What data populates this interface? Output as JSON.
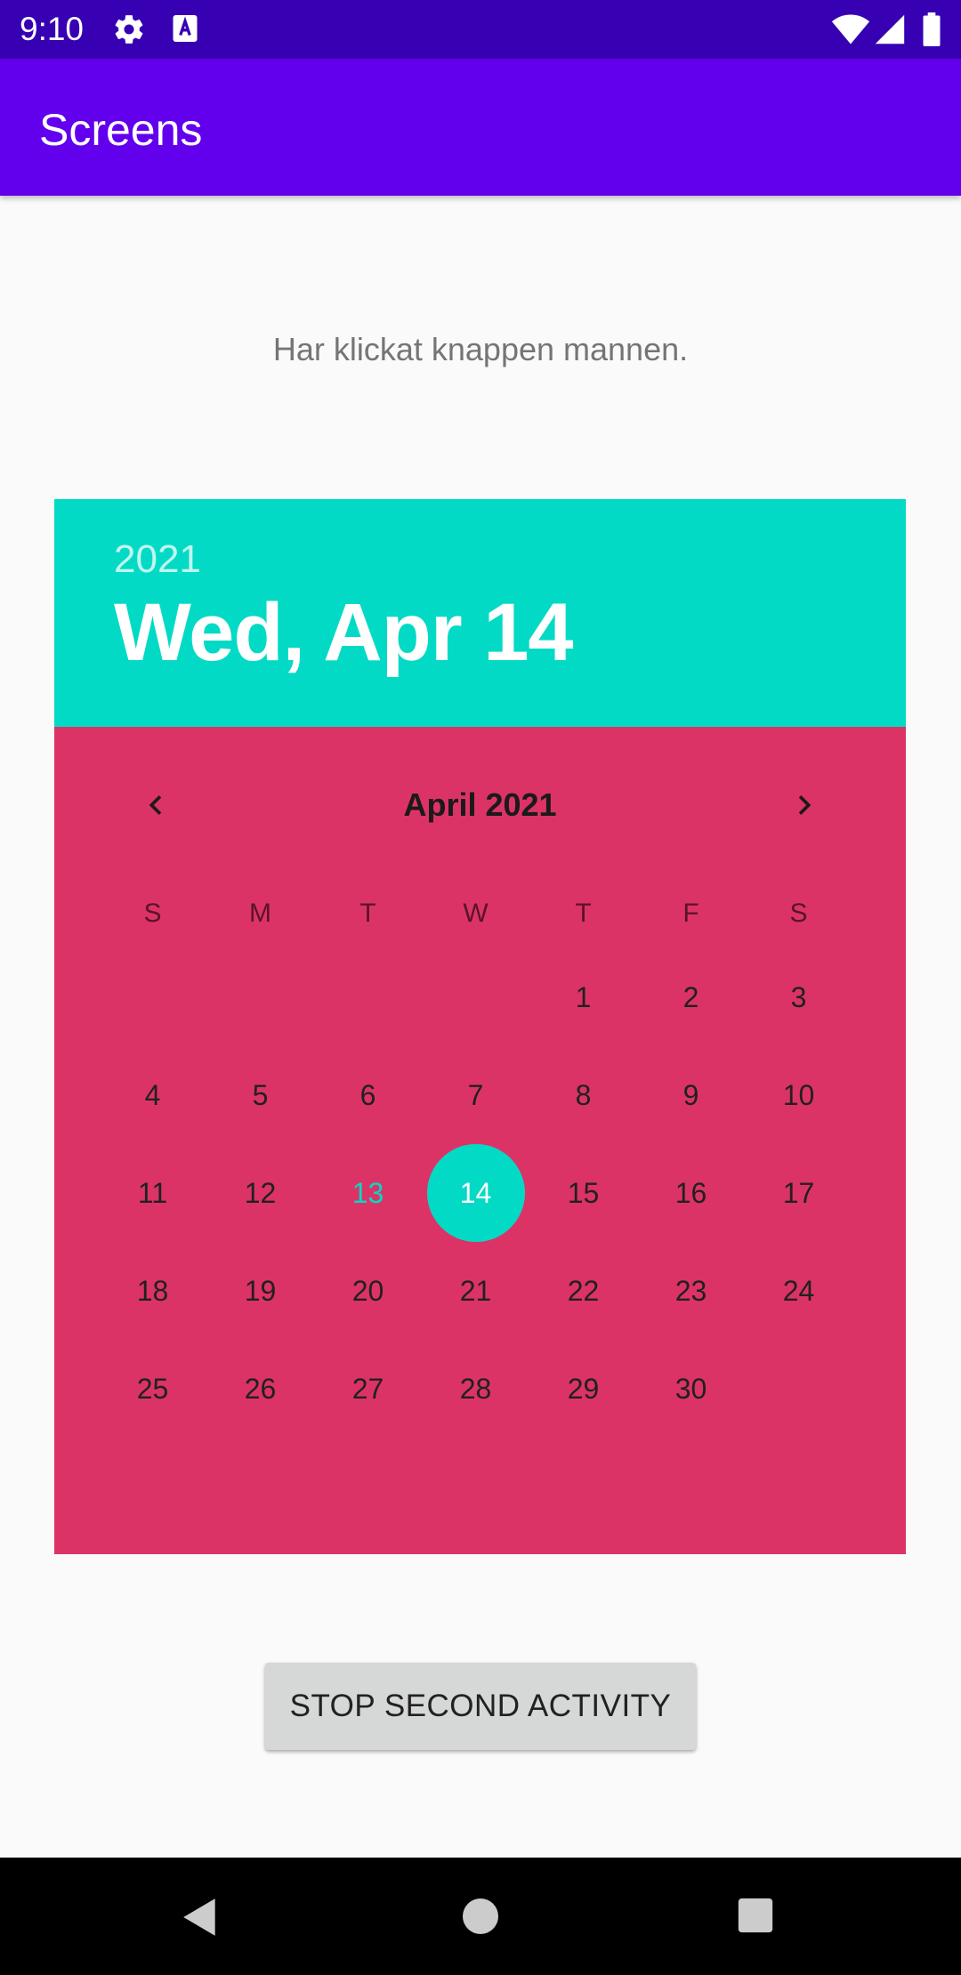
{
  "status_bar": {
    "time": "9:10",
    "icons": [
      "gear-icon",
      "text-a-icon",
      "wifi-icon",
      "signal-icon",
      "battery-icon"
    ]
  },
  "app_bar": {
    "title": "Screens"
  },
  "content": {
    "message": "Har klickat knappen mannen."
  },
  "date_picker": {
    "colors": {
      "header": "#03dac5",
      "body": "#dc3366",
      "selection": "#03dac5"
    },
    "header": {
      "year": "2021",
      "date": "Wed, Apr 14"
    },
    "month_label": "April 2021",
    "prev_icon": "chevron-left-icon",
    "next_icon": "chevron-right-icon",
    "weekdays": [
      "S",
      "M",
      "T",
      "W",
      "T",
      "F",
      "S"
    ],
    "leading_blank_days": 4,
    "days": [
      "1",
      "2",
      "3",
      "4",
      "5",
      "6",
      "7",
      "8",
      "9",
      "10",
      "11",
      "12",
      "13",
      "14",
      "15",
      "16",
      "17",
      "18",
      "19",
      "20",
      "21",
      "22",
      "23",
      "24",
      "25",
      "26",
      "27",
      "28",
      "29",
      "30"
    ],
    "today": "13",
    "selected": "14"
  },
  "button": {
    "label": "STOP SECOND ACTIVITY"
  },
  "nav_bar": {
    "icons": [
      "back-icon",
      "home-icon",
      "recents-icon"
    ]
  }
}
